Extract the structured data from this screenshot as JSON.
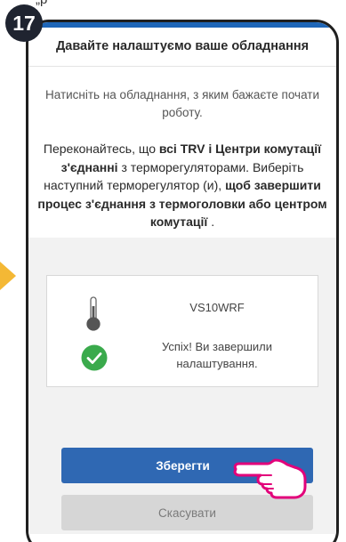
{
  "top_fragment": "„р",
  "step_number": "17",
  "screen": {
    "title": "Давайте налаштуємо ваше обладнання",
    "instruction": "Натисніть на обладнання, з яким бажаєте почати роботу.",
    "confirm": {
      "part1": "Переконайтесь, що ",
      "bold1": "всі TRV і Центри комутації з'єднанні",
      "part2": " з терморегуляторами. Виберіть наступний терморегулятор (и), ",
      "bold2": "щоб завершити процес з'єднання з термоголовки або центром комутації",
      "part3": " ."
    },
    "device": {
      "name": "VS10WRF",
      "status": "Успіх! Ви завершили налаштування.",
      "device_icon": "thermometer-icon",
      "status_icon": "check-circle-icon"
    },
    "save_label": "Зберегти",
    "cancel_label": "Скасувати"
  },
  "colors": {
    "accent": "#2f68b3",
    "success": "#3aaa4c",
    "arrow": "#f4b835",
    "cancel": "#d6d6d6"
  }
}
